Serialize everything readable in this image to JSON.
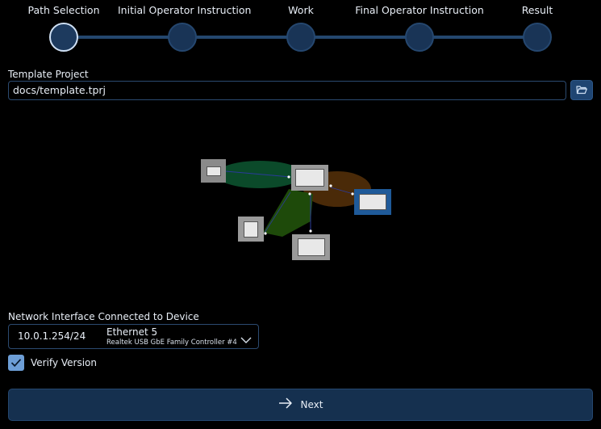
{
  "stepper": {
    "steps": [
      {
        "label": "Path Selection",
        "active": true
      },
      {
        "label": "Initial Operator Instruction",
        "active": false
      },
      {
        "label": "Work",
        "active": false
      },
      {
        "label": "Final Operator Instruction",
        "active": false
      },
      {
        "label": "Result",
        "active": false
      }
    ]
  },
  "template": {
    "label": "Template Project",
    "value": "docs/template.tprj",
    "browse_icon": "folder-open-icon"
  },
  "network": {
    "label": "Network Interface Connected to Device",
    "ip": "10.0.1.254/24",
    "name": "Ethernet 5",
    "description": "Realtek USB GbE Family Controller #4",
    "chevron_icon": "chevron-down-icon"
  },
  "verify": {
    "label": "Verify Version",
    "checked": true
  },
  "next": {
    "label": "Next",
    "icon": "arrow-right-icon"
  },
  "colors": {
    "accent": "#1f4572",
    "step_active_border": "#cfe0f4",
    "step_track": "#24476e",
    "zone_green": "#0b4a2a",
    "zone_brown": "#4a2a08",
    "zone_olive": "#1e4a0a",
    "node_selected": "#1f5a99"
  }
}
